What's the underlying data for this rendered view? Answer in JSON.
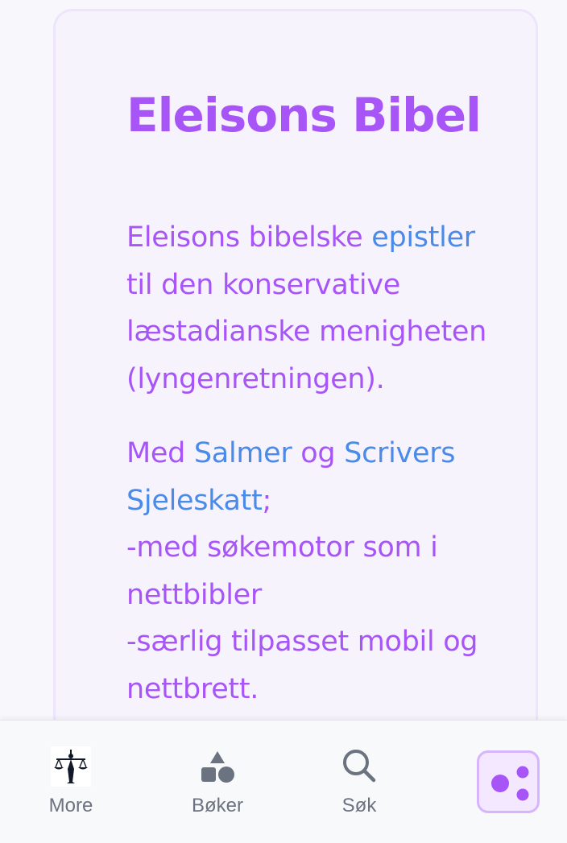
{
  "article": {
    "title": "Eleisons Bibel",
    "intro": {
      "before_link": "Eleisons bibelske ",
      "link_epistler": "epistler",
      "line2": "til den konservative",
      "line3": "læstadianske menigheten",
      "line4": "(lyngenretningen)."
    },
    "second": {
      "med": "Med ",
      "link_salmer": "Salmer",
      "og": " og ",
      "link_scrivers": "Scrivers",
      "link_sjeleskatt": "Sjeleskatt",
      "semicolon": ";",
      "line3": "-med søkemotor som i",
      "line4": "nettbibler",
      "line5": "-særlig tilpasset mobil og",
      "line6": "nettbrett."
    }
  },
  "tabbar": {
    "more_label": "More",
    "boker_label": "Bøker",
    "sok_label": "Søk"
  },
  "icons": {
    "more": "justice-scales-logo-icon",
    "boker": "shapes-icon",
    "sok": "search-icon",
    "menu": "dots-menu-icon"
  },
  "colors": {
    "accent_purple": "#a855f7",
    "link_blue": "#4a8be9",
    "tab_gray": "#6b7280"
  }
}
